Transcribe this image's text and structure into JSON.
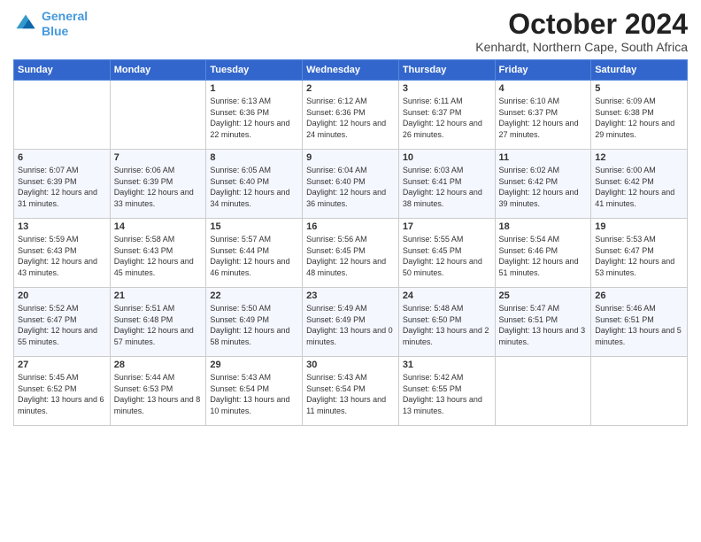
{
  "header": {
    "logo_line1": "General",
    "logo_line2": "Blue",
    "month_title": "October 2024",
    "subtitle": "Kenhardt, Northern Cape, South Africa"
  },
  "days_of_week": [
    "Sunday",
    "Monday",
    "Tuesday",
    "Wednesday",
    "Thursday",
    "Friday",
    "Saturday"
  ],
  "weeks": [
    [
      {
        "day": "",
        "info": ""
      },
      {
        "day": "",
        "info": ""
      },
      {
        "day": "1",
        "info": "Sunrise: 6:13 AM\nSunset: 6:36 PM\nDaylight: 12 hours and 22 minutes."
      },
      {
        "day": "2",
        "info": "Sunrise: 6:12 AM\nSunset: 6:36 PM\nDaylight: 12 hours and 24 minutes."
      },
      {
        "day": "3",
        "info": "Sunrise: 6:11 AM\nSunset: 6:37 PM\nDaylight: 12 hours and 26 minutes."
      },
      {
        "day": "4",
        "info": "Sunrise: 6:10 AM\nSunset: 6:37 PM\nDaylight: 12 hours and 27 minutes."
      },
      {
        "day": "5",
        "info": "Sunrise: 6:09 AM\nSunset: 6:38 PM\nDaylight: 12 hours and 29 minutes."
      }
    ],
    [
      {
        "day": "6",
        "info": "Sunrise: 6:07 AM\nSunset: 6:39 PM\nDaylight: 12 hours and 31 minutes."
      },
      {
        "day": "7",
        "info": "Sunrise: 6:06 AM\nSunset: 6:39 PM\nDaylight: 12 hours and 33 minutes."
      },
      {
        "day": "8",
        "info": "Sunrise: 6:05 AM\nSunset: 6:40 PM\nDaylight: 12 hours and 34 minutes."
      },
      {
        "day": "9",
        "info": "Sunrise: 6:04 AM\nSunset: 6:40 PM\nDaylight: 12 hours and 36 minutes."
      },
      {
        "day": "10",
        "info": "Sunrise: 6:03 AM\nSunset: 6:41 PM\nDaylight: 12 hours and 38 minutes."
      },
      {
        "day": "11",
        "info": "Sunrise: 6:02 AM\nSunset: 6:42 PM\nDaylight: 12 hours and 39 minutes."
      },
      {
        "day": "12",
        "info": "Sunrise: 6:00 AM\nSunset: 6:42 PM\nDaylight: 12 hours and 41 minutes."
      }
    ],
    [
      {
        "day": "13",
        "info": "Sunrise: 5:59 AM\nSunset: 6:43 PM\nDaylight: 12 hours and 43 minutes."
      },
      {
        "day": "14",
        "info": "Sunrise: 5:58 AM\nSunset: 6:43 PM\nDaylight: 12 hours and 45 minutes."
      },
      {
        "day": "15",
        "info": "Sunrise: 5:57 AM\nSunset: 6:44 PM\nDaylight: 12 hours and 46 minutes."
      },
      {
        "day": "16",
        "info": "Sunrise: 5:56 AM\nSunset: 6:45 PM\nDaylight: 12 hours and 48 minutes."
      },
      {
        "day": "17",
        "info": "Sunrise: 5:55 AM\nSunset: 6:45 PM\nDaylight: 12 hours and 50 minutes."
      },
      {
        "day": "18",
        "info": "Sunrise: 5:54 AM\nSunset: 6:46 PM\nDaylight: 12 hours and 51 minutes."
      },
      {
        "day": "19",
        "info": "Sunrise: 5:53 AM\nSunset: 6:47 PM\nDaylight: 12 hours and 53 minutes."
      }
    ],
    [
      {
        "day": "20",
        "info": "Sunrise: 5:52 AM\nSunset: 6:47 PM\nDaylight: 12 hours and 55 minutes."
      },
      {
        "day": "21",
        "info": "Sunrise: 5:51 AM\nSunset: 6:48 PM\nDaylight: 12 hours and 57 minutes."
      },
      {
        "day": "22",
        "info": "Sunrise: 5:50 AM\nSunset: 6:49 PM\nDaylight: 12 hours and 58 minutes."
      },
      {
        "day": "23",
        "info": "Sunrise: 5:49 AM\nSunset: 6:49 PM\nDaylight: 13 hours and 0 minutes."
      },
      {
        "day": "24",
        "info": "Sunrise: 5:48 AM\nSunset: 6:50 PM\nDaylight: 13 hours and 2 minutes."
      },
      {
        "day": "25",
        "info": "Sunrise: 5:47 AM\nSunset: 6:51 PM\nDaylight: 13 hours and 3 minutes."
      },
      {
        "day": "26",
        "info": "Sunrise: 5:46 AM\nSunset: 6:51 PM\nDaylight: 13 hours and 5 minutes."
      }
    ],
    [
      {
        "day": "27",
        "info": "Sunrise: 5:45 AM\nSunset: 6:52 PM\nDaylight: 13 hours and 6 minutes."
      },
      {
        "day": "28",
        "info": "Sunrise: 5:44 AM\nSunset: 6:53 PM\nDaylight: 13 hours and 8 minutes."
      },
      {
        "day": "29",
        "info": "Sunrise: 5:43 AM\nSunset: 6:54 PM\nDaylight: 13 hours and 10 minutes."
      },
      {
        "day": "30",
        "info": "Sunrise: 5:43 AM\nSunset: 6:54 PM\nDaylight: 13 hours and 11 minutes."
      },
      {
        "day": "31",
        "info": "Sunrise: 5:42 AM\nSunset: 6:55 PM\nDaylight: 13 hours and 13 minutes."
      },
      {
        "day": "",
        "info": ""
      },
      {
        "day": "",
        "info": ""
      }
    ]
  ]
}
